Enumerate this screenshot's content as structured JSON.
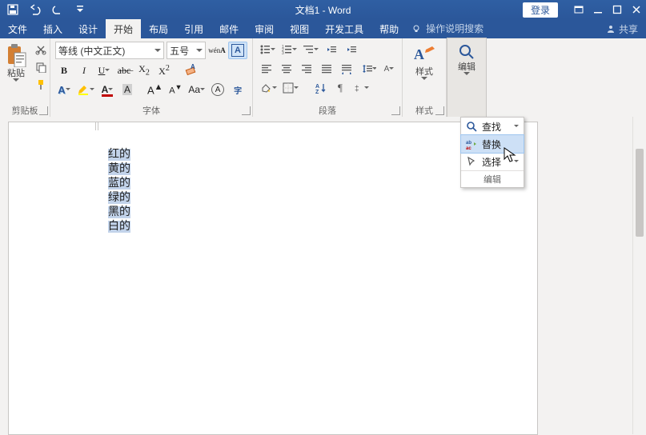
{
  "titlebar": {
    "title": "文档1 - Word",
    "login": "登录"
  },
  "tabs": {
    "file": "文件",
    "insert": "插入",
    "design": "设计",
    "home": "开始",
    "layout": "布局",
    "references": "引用",
    "mailings": "邮件",
    "review": "审阅",
    "view": "视图",
    "developer": "开发工具",
    "help": "帮助",
    "tell_me_placeholder": "操作说明搜索",
    "share": "共享"
  },
  "ribbon": {
    "clipboard": {
      "paste": "粘贴",
      "label": "剪贴板"
    },
    "font": {
      "name": "等线 (中文正文)",
      "size": "五号",
      "label": "字体"
    },
    "paragraph": {
      "label": "段落"
    },
    "styles": {
      "btn": "样式",
      "label": "样式"
    },
    "editing": {
      "btn": "编辑",
      "label": "编辑"
    }
  },
  "editing_menu": {
    "find": "查找",
    "replace": "替换",
    "select": "选择",
    "section": "编辑"
  },
  "document": {
    "lines": [
      "红的",
      "黄的",
      "蓝的",
      "绿的",
      "黑的",
      "白的"
    ]
  }
}
